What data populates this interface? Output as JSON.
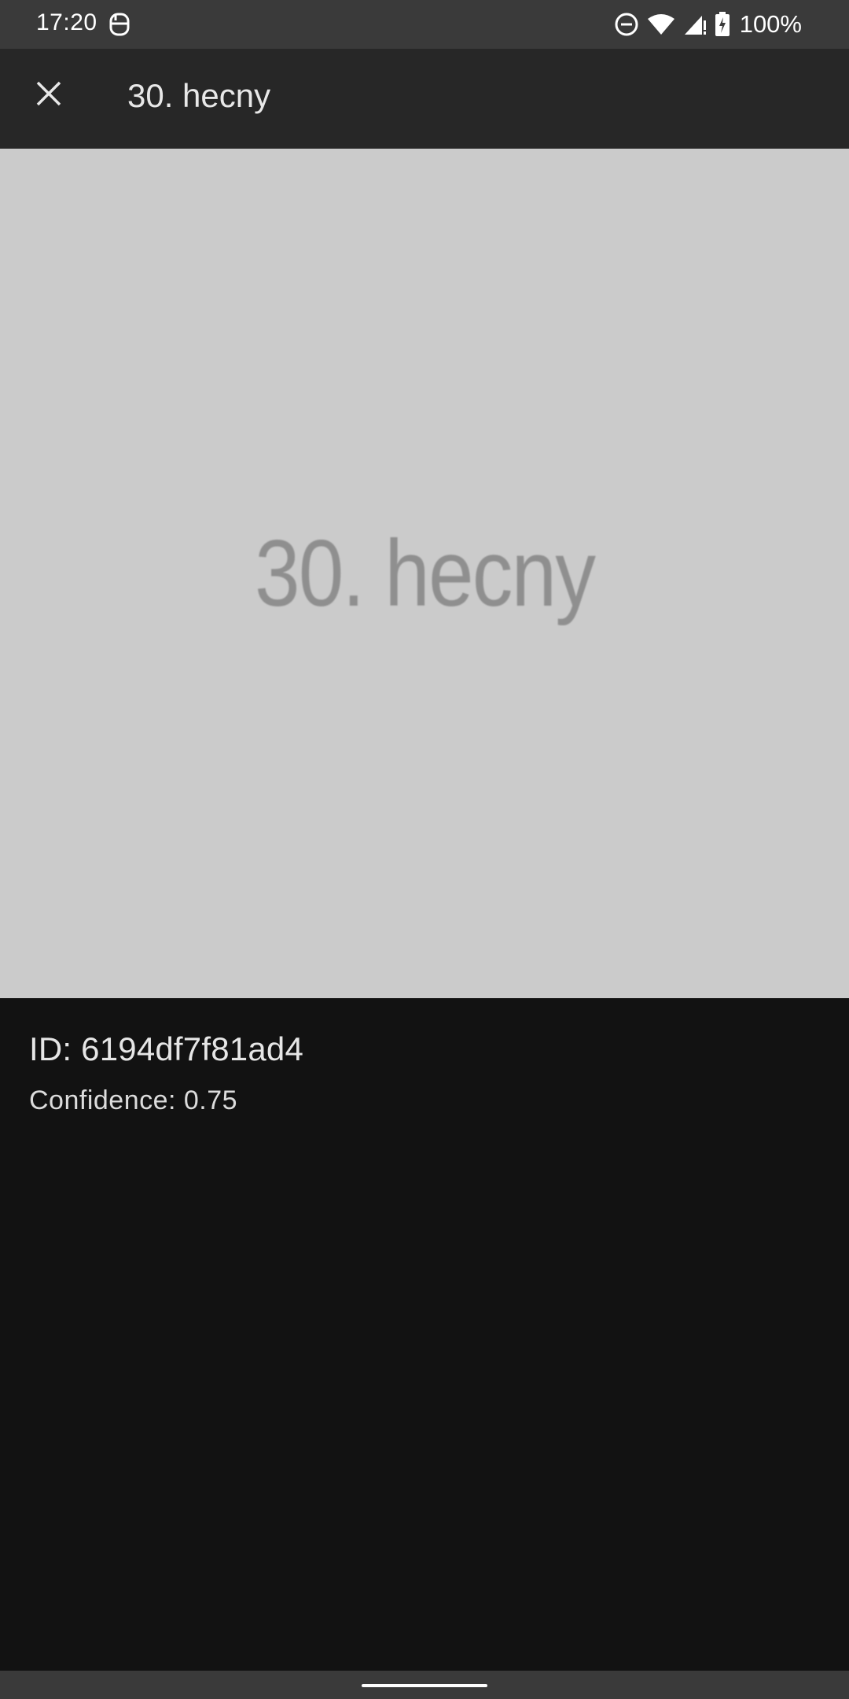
{
  "status_bar": {
    "time": "17:20",
    "battery_percent": "100%",
    "icons": [
      "notification-icon",
      "do-not-disturb-icon",
      "wifi-icon",
      "cell-signal-icon",
      "battery-charging-icon"
    ]
  },
  "app_bar": {
    "title": "30. hecny",
    "close_icon": "close-icon"
  },
  "preview": {
    "image_text": "30. hecny"
  },
  "details": {
    "id_label": "ID: 6194df7f81ad4",
    "confidence_label": "Confidence: 0.75"
  },
  "colors": {
    "status_bar_bg": "#3a3a3a",
    "app_bar_bg": "#272727",
    "preview_bg": "#cbcbcb",
    "page_bg": "#121212",
    "text_primary": "#e6e6e6"
  }
}
